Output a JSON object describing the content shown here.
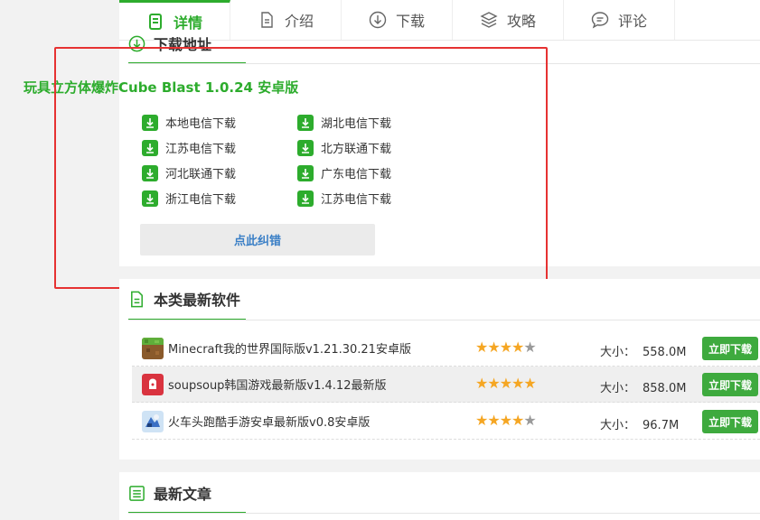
{
  "tabs": [
    {
      "label": "详情",
      "icon": "doc-icon",
      "active": true
    },
    {
      "label": "介绍",
      "icon": "file-icon",
      "active": false
    },
    {
      "label": "下载",
      "icon": "download-circle-icon",
      "active": false
    },
    {
      "label": "攻略",
      "icon": "layers-icon",
      "active": false
    },
    {
      "label": "评论",
      "icon": "comment-icon",
      "active": false
    }
  ],
  "download_section": {
    "heading": "下载地址",
    "app_title": "玩具立方体爆炸Cube Blast 1.0.24 安卓版",
    "links_left": [
      "本地电信下载",
      "江苏电信下载",
      "河北联通下载",
      "浙江电信下载"
    ],
    "links_right": [
      "湖北电信下载",
      "北方联通下载",
      "广东电信下载",
      "江苏电信下载"
    ],
    "report_label": "点此纠错"
  },
  "latest_software": {
    "heading": "本类最新软件",
    "size_label": "大小：",
    "download_label": "立即下载",
    "items": [
      {
        "name": "Minecraft我的世界国际版v1.21.30.21安卓版",
        "rating": 4,
        "size": "558.0M"
      },
      {
        "name": "soupsoup韩国游戏最新版v1.4.12最新版",
        "rating": 5,
        "size": "858.0M"
      },
      {
        "name": "火车头跑酷手游安卓最新版v0.8安卓版",
        "rating": 4,
        "size": "96.7M"
      }
    ]
  },
  "latest_articles": {
    "heading": "最新文章"
  },
  "colors": {
    "accent": "#2dac2d",
    "highlight_box": "#e63232",
    "link_blue": "#3a7fc6",
    "star": "#f5a623"
  }
}
